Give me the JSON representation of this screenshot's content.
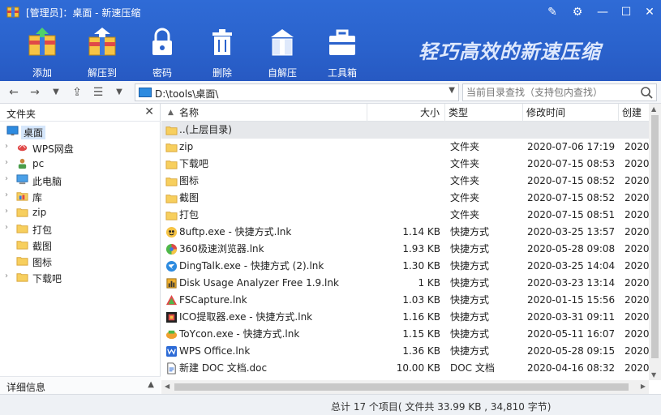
{
  "window": {
    "title": "[管理员]：桌面 - 新速压缩",
    "controls": [
      "edit-icon",
      "settings-icon",
      "minimize-icon",
      "close-icon"
    ]
  },
  "toolbar": {
    "items": [
      {
        "label": "添加",
        "icon": "add-archive-icon"
      },
      {
        "label": "解压到",
        "icon": "extract-icon"
      },
      {
        "label": "密码",
        "icon": "lock-icon"
      },
      {
        "label": "删除",
        "icon": "trash-icon"
      },
      {
        "label": "自解压",
        "icon": "self-extract-icon"
      },
      {
        "label": "工具箱",
        "icon": "toolbox-icon"
      }
    ],
    "slogan": "轻巧高效的新速压缩"
  },
  "nav": {
    "address": "D:\\tools\\桌面\\",
    "search_placeholder": "当前目录查找（支持包内查找）"
  },
  "left_panel": {
    "header": "文件夹",
    "footer": "详细信息",
    "tree": [
      {
        "label": "桌面",
        "selected": true,
        "expandable": false,
        "icon": "desktop-icon"
      },
      {
        "label": "WPS网盘",
        "expandable": true,
        "icon": "cloud-icon"
      },
      {
        "label": "pc",
        "expandable": true,
        "icon": "user-icon"
      },
      {
        "label": "此电脑",
        "expandable": true,
        "icon": "computer-icon"
      },
      {
        "label": "库",
        "expandable": true,
        "icon": "library-icon"
      },
      {
        "label": "zip",
        "expandable": true,
        "icon": "folder-icon"
      },
      {
        "label": "打包",
        "expandable": true,
        "icon": "folder-icon"
      },
      {
        "label": "截图",
        "expandable": false,
        "icon": "folder-icon"
      },
      {
        "label": "图标",
        "expandable": false,
        "icon": "folder-icon"
      },
      {
        "label": "下载吧",
        "expandable": true,
        "icon": "folder-icon"
      }
    ]
  },
  "file_list": {
    "columns": [
      "名称",
      "大小",
      "类型",
      "修改时间",
      "创建"
    ],
    "rows": [
      {
        "name": "..(上层目录)",
        "size": "",
        "type": "",
        "date": "",
        "created": "",
        "icon": "folder-icon"
      },
      {
        "name": "zip",
        "size": "",
        "type": "文件夹",
        "date": "2020-07-06 17:19",
        "created": "2020",
        "icon": "folder-icon"
      },
      {
        "name": "下载吧",
        "size": "",
        "type": "文件夹",
        "date": "2020-07-15 08:53",
        "created": "2020",
        "icon": "folder-icon"
      },
      {
        "name": "图标",
        "size": "",
        "type": "文件夹",
        "date": "2020-07-15 08:52",
        "created": "2020",
        "icon": "folder-icon"
      },
      {
        "name": "截图",
        "size": "",
        "type": "文件夹",
        "date": "2020-07-15 08:52",
        "created": "2020",
        "icon": "folder-icon"
      },
      {
        "name": "打包",
        "size": "",
        "type": "文件夹",
        "date": "2020-07-15 08:51",
        "created": "2020",
        "icon": "folder-icon"
      },
      {
        "name": "8uftp.exe - 快捷方式.lnk",
        "size": "1.14 KB",
        "type": "快捷方式",
        "date": "2020-03-25 13:57",
        "created": "2020",
        "icon": "ftp-app-icon"
      },
      {
        "name": "360极速浏览器.lnk",
        "size": "1.93 KB",
        "type": "快捷方式",
        "date": "2020-05-28 09:08",
        "created": "2020",
        "icon": "browser-icon"
      },
      {
        "name": "DingTalk.exe - 快捷方式 (2).lnk",
        "size": "1.30 KB",
        "type": "快捷方式",
        "date": "2020-03-25 14:04",
        "created": "2020",
        "icon": "dingtalk-icon"
      },
      {
        "name": "Disk Usage Analyzer Free 1.9.lnk",
        "size": "1 KB",
        "type": "快捷方式",
        "date": "2020-03-23 13:14",
        "created": "2020",
        "icon": "disk-analyzer-icon"
      },
      {
        "name": "FSCapture.lnk",
        "size": "1.03 KB",
        "type": "快捷方式",
        "date": "2020-01-15 15:56",
        "created": "2020",
        "icon": "capture-icon"
      },
      {
        "name": "ICO提取器.exe - 快捷方式.lnk",
        "size": "1.16 KB",
        "type": "快捷方式",
        "date": "2020-03-31 09:11",
        "created": "2020",
        "icon": "ico-extractor-icon"
      },
      {
        "name": "ToYcon.exe - 快捷方式.lnk",
        "size": "1.15 KB",
        "type": "快捷方式",
        "date": "2020-05-11 16:07",
        "created": "2020",
        "icon": "toycon-icon"
      },
      {
        "name": "WPS Office.lnk",
        "size": "1.36 KB",
        "type": "快捷方式",
        "date": "2020-05-28 09:15",
        "created": "2020",
        "icon": "wps-icon"
      },
      {
        "name": "新建 DOC 文档.doc",
        "size": "10.00 KB",
        "type": "DOC 文档",
        "date": "2020-04-16 08:32",
        "created": "2020",
        "icon": "doc-icon"
      }
    ]
  },
  "status": {
    "text": "总计 17 个项目( 文件共 33.99 KB , 34,810 字节)"
  },
  "colors": {
    "toolbar_blue": "#2a62cc",
    "selection": "#d5e6fb",
    "folder": "#f7cf5e"
  }
}
